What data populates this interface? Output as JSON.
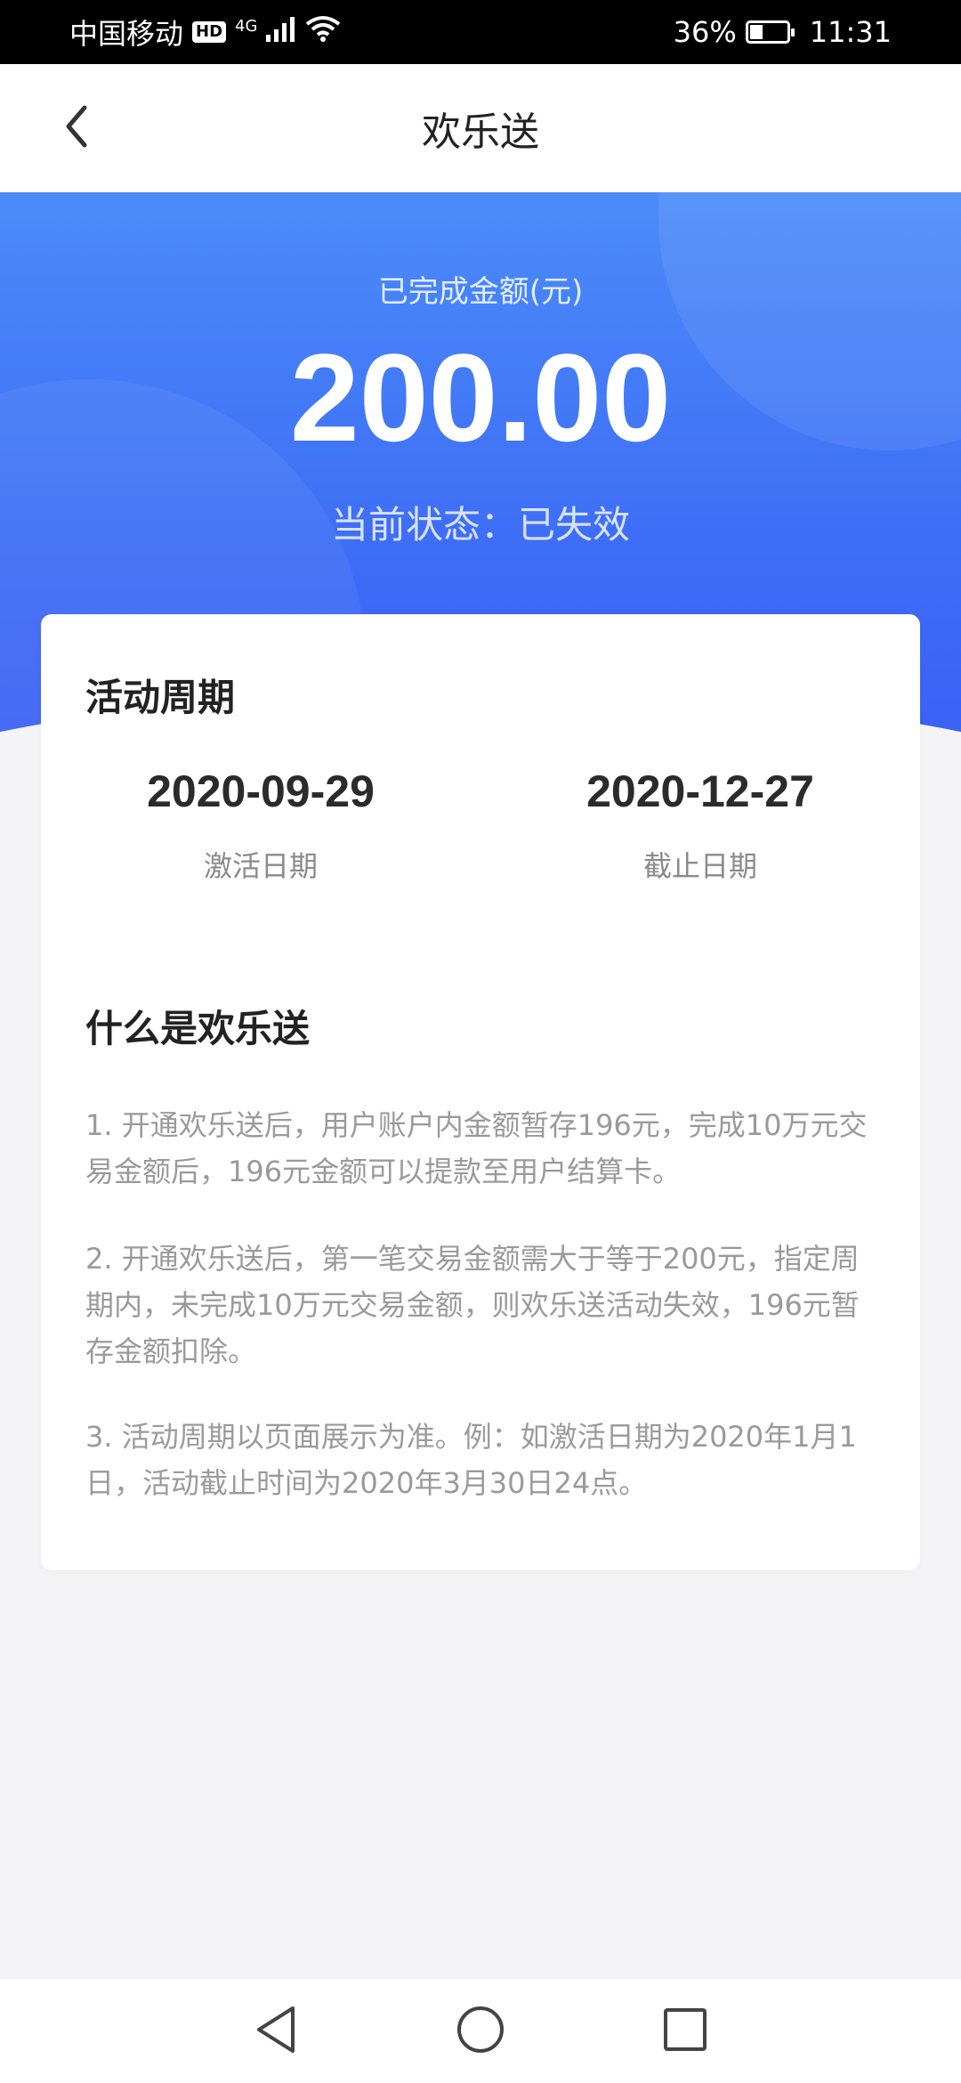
{
  "status_bar": {
    "carrier": "中国移动",
    "hd": "HD",
    "network": "4G",
    "battery": "36%",
    "time": "11:31"
  },
  "nav": {
    "title": "欢乐送",
    "back_icon": "chevron-left-icon"
  },
  "summary": {
    "label": "已完成金额(元)",
    "amount": "200.00",
    "status": "当前状态：已失效"
  },
  "period": {
    "title": "活动周期",
    "start_date": "2020-09-29",
    "start_label": "激活日期",
    "end_date": "2020-12-27",
    "end_label": "截止日期"
  },
  "about": {
    "title": "什么是欢乐送",
    "items": [
      "1. 开通欢乐送后，用户账户内金额暂存196元，完成10万元交易金额后，196元金额可以提款至用户结算卡。",
      "2. 开通欢乐送后，第一笔交易金额需大于等于200元，指定周期内，未完成10万元交易金额，则欢乐送活动失效，196元暂存金额扣除。",
      "3. 活动周期以页面展示为准。例：如激活日期为2020年1月1日，活动截止时间为2020年3月30日24点。"
    ]
  },
  "colors": {
    "hero_top": "#4b8cf9",
    "hero_bottom": "#3b5cf5",
    "background": "#f4f4f6"
  },
  "system_nav": {
    "back_icon": "triangle-back-icon",
    "home_icon": "circle-home-icon",
    "recents_icon": "square-recents-icon"
  }
}
